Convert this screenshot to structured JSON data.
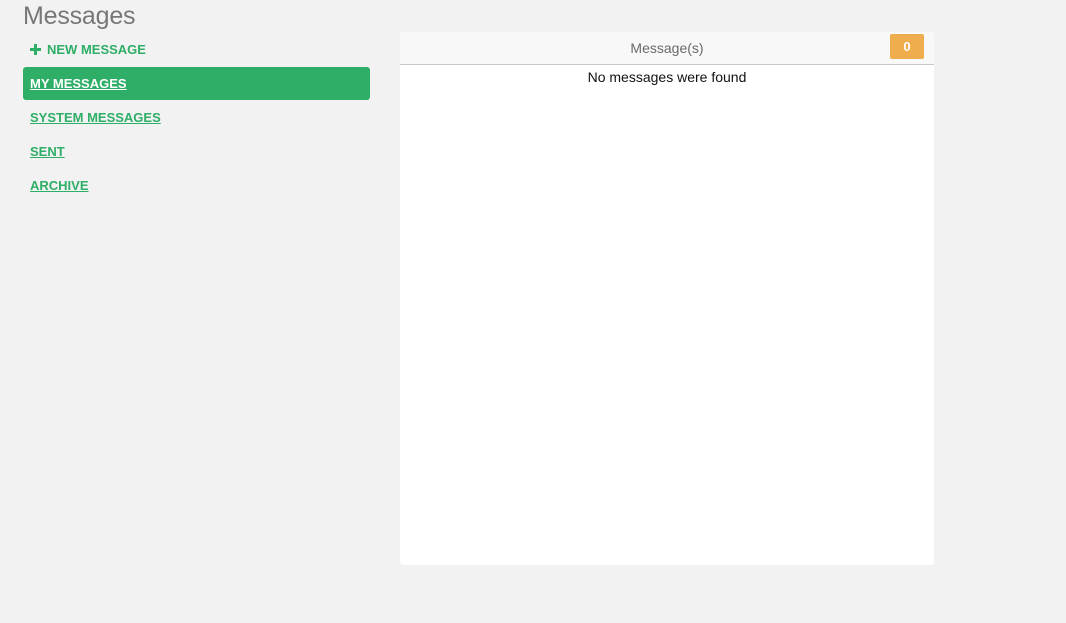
{
  "page": {
    "title": "Messages"
  },
  "sidebar": {
    "new_message_label": "NEW MESSAGE",
    "items": [
      {
        "label": "MY MESSAGES",
        "active": true
      },
      {
        "label": "SYSTEM MESSAGES",
        "active": false
      },
      {
        "label": "SENT",
        "active": false
      },
      {
        "label": "ARCHIVE",
        "active": false
      }
    ]
  },
  "panel": {
    "header": "Message(s)",
    "count": "0",
    "empty_message": "No messages were found"
  },
  "colors": {
    "accent": "#2eae67",
    "badge": "#f0ad4e",
    "background": "#f2f2f2"
  },
  "icons": {
    "new_message": "plus-icon"
  }
}
